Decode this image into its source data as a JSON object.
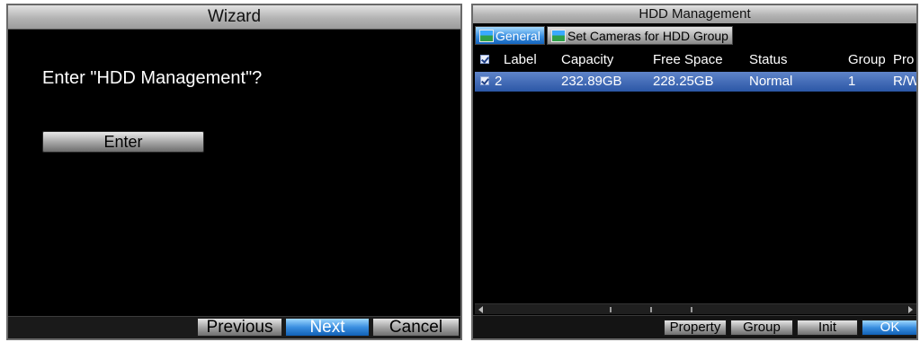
{
  "wizard": {
    "title": "Wizard",
    "prompt": "Enter \"HDD Management\"?",
    "enter_label": "Enter",
    "previous_label": "Previous",
    "next_label": "Next",
    "cancel_label": "Cancel"
  },
  "hdd": {
    "title": "HDD Management",
    "tabs": [
      {
        "label": "General",
        "icon": "image-icon",
        "active": true
      },
      {
        "label": "Set Cameras for HDD Group",
        "icon": "image-icon",
        "active": false
      }
    ],
    "columns": [
      "Label",
      "Capacity",
      "Free Space",
      "Status",
      "Group",
      "Pro"
    ],
    "rows": [
      {
        "label": "2",
        "capacity": "232.89GB",
        "free_space": "228.25GB",
        "status": "Normal",
        "group": "1",
        "property": "R/W"
      }
    ],
    "buttons": {
      "property": "Property",
      "group": "Group",
      "init": "Init",
      "ok": "OK"
    },
    "colors": {
      "accent": "#3a8fe0",
      "selected_row": "#2b57a6"
    }
  }
}
